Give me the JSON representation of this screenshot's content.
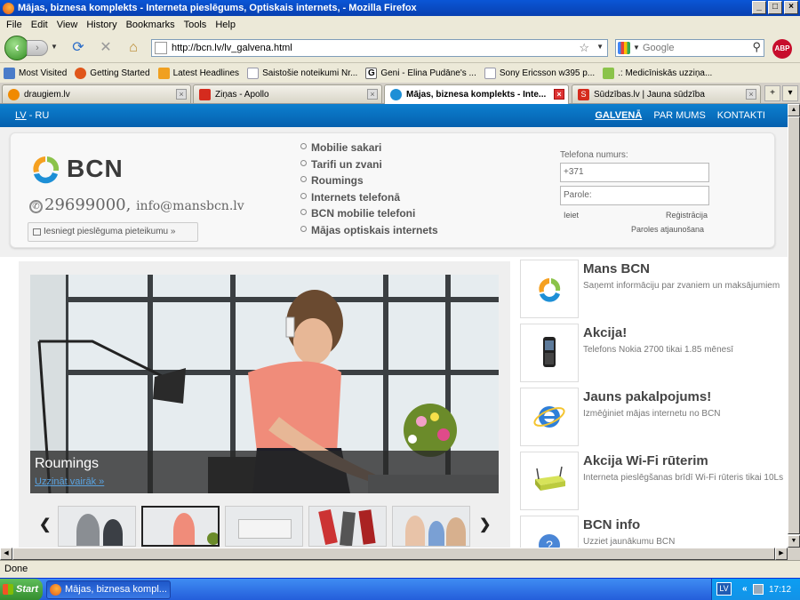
{
  "window": {
    "title": "Mājas, biznesa komplekts - Interneta pieslēgums, Optiskais internets, - Mozilla Firefox"
  },
  "menu": [
    "File",
    "Edit",
    "View",
    "History",
    "Bookmarks",
    "Tools",
    "Help"
  ],
  "nav": {
    "url": "http://bcn.lv/lv_galvena.html",
    "search_placeholder": "Google",
    "abp_label": "ABP"
  },
  "bookmarks": [
    {
      "label": "Most Visited",
      "color": "#4a7cc9"
    },
    {
      "label": "Getting Started",
      "color": "#e0561a"
    },
    {
      "label": "Latest Headlines",
      "color": "#f0a020"
    },
    {
      "label": "Saistošie noteikumi Nr...",
      "color": "#ffffff"
    },
    {
      "label": "Geni - Elina Pudāne's ...",
      "color": "#4a4a4a"
    },
    {
      "label": "Sony Ericsson w395 p...",
      "color": "#ffffff"
    },
    {
      "label": ".: Medicīniskās uzziņa...",
      "color": "#8bc34a"
    }
  ],
  "tabs": [
    {
      "label": "draugiem.lv",
      "color": "#f08a00"
    },
    {
      "label": "Ziņas - Apollo",
      "color": "#d52b1e"
    },
    {
      "label": "Mājas, biznesa komplekts - Inte...",
      "color": "#1d8fd6"
    },
    {
      "label": "Sūdzības.lv | Jauna sūdzība",
      "color": "#d52b1e"
    }
  ],
  "status": "Done",
  "taskbar": {
    "start": "Start",
    "item": "Mājas, biznesa kompl...",
    "lang": "LV",
    "chev": "«",
    "time": "17:12"
  },
  "page": {
    "lang_lv": "LV",
    "lang_sep": " - ",
    "lang_ru": "RU",
    "topmenu": [
      "GALVENĀ",
      "PAR MUMS",
      "KONTAKTI"
    ],
    "logo_text": "BCN",
    "phone": "29699000,",
    "email": "info@mansbcn.lv",
    "apply_btn": "Iesniegt pieslēguma pieteikumu »",
    "services": [
      "Mobilie sakari",
      "Tarifi un zvani",
      "Roumings",
      "Internets telefonā",
      "BCN mobilie telefoni",
      "Mājas optiskais internets"
    ],
    "login": {
      "phone_label": "Telefona numurs:",
      "phone_value": "+371",
      "password_placeholder": "Parole:",
      "enter": "Ieiet",
      "register": "Reģistrācija",
      "forgot": "Paroles atjaunošana"
    },
    "slide": {
      "title": "Roumings",
      "link": "Uzzināt vairāk »"
    },
    "promos": [
      {
        "title": "Mans BCN",
        "desc": "Saņemt informāciju par zvaniem un maksājumiem",
        "icon": "bcn-logo-icon"
      },
      {
        "title": "Akcija!",
        "desc": "Telefons Nokia 2700 tikai 1.85 mēnesī",
        "icon": "mobile-phone-icon"
      },
      {
        "title": "Jauns pakalpojums!",
        "desc": "Izmēģiniet mājas internetu no BCN",
        "icon": "internet-explorer-icon"
      },
      {
        "title": "Akcija Wi-Fi rūterim",
        "desc": "Interneta pieslēgšanas brīdī Wi-Fi rūteris tikai 10Ls",
        "icon": "wifi-router-icon"
      },
      {
        "title": "BCN info",
        "desc": "Uzziet jaunākumu BCN",
        "icon": "info-icon"
      }
    ]
  }
}
